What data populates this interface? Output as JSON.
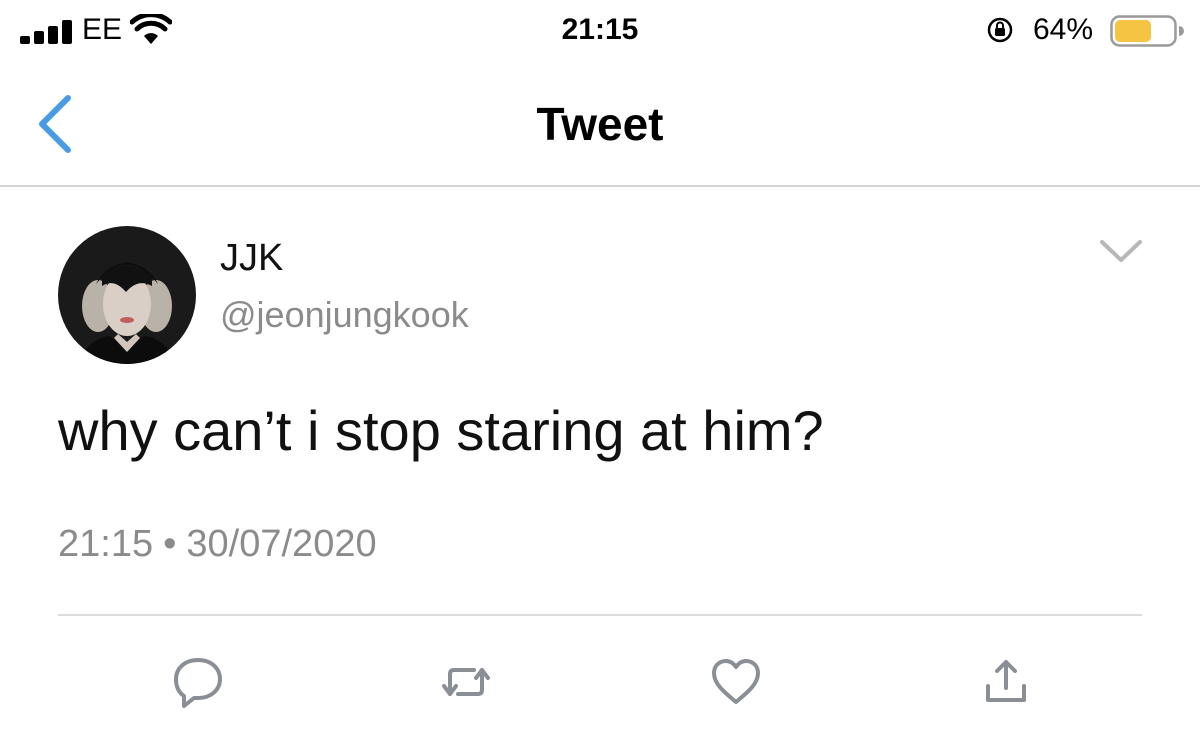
{
  "status_bar": {
    "carrier": "EE",
    "time": "21:15",
    "battery_percent": "64%",
    "battery_level": 0.64,
    "battery_color": "#f5c442",
    "icons": [
      "signal-icon",
      "wifi-icon",
      "rotation-lock-icon",
      "battery-icon"
    ]
  },
  "nav": {
    "title": "Tweet",
    "back_icon": "chevron-left-icon",
    "accent_color": "#4a9be6"
  },
  "tweet": {
    "display_name": "JJK",
    "handle": "@jeonjungkook",
    "text": "why can’t i stop staring at him?",
    "time": "21:15",
    "separator": "•",
    "date": "30/07/2020"
  },
  "actions": [
    {
      "name": "reply",
      "icon": "reply-icon"
    },
    {
      "name": "retweet",
      "icon": "retweet-icon"
    },
    {
      "name": "like",
      "icon": "heart-icon"
    },
    {
      "name": "share",
      "icon": "share-icon"
    }
  ],
  "colors": {
    "secondary_text": "#8b8b8b",
    "icon_gray": "#8a8f96"
  }
}
